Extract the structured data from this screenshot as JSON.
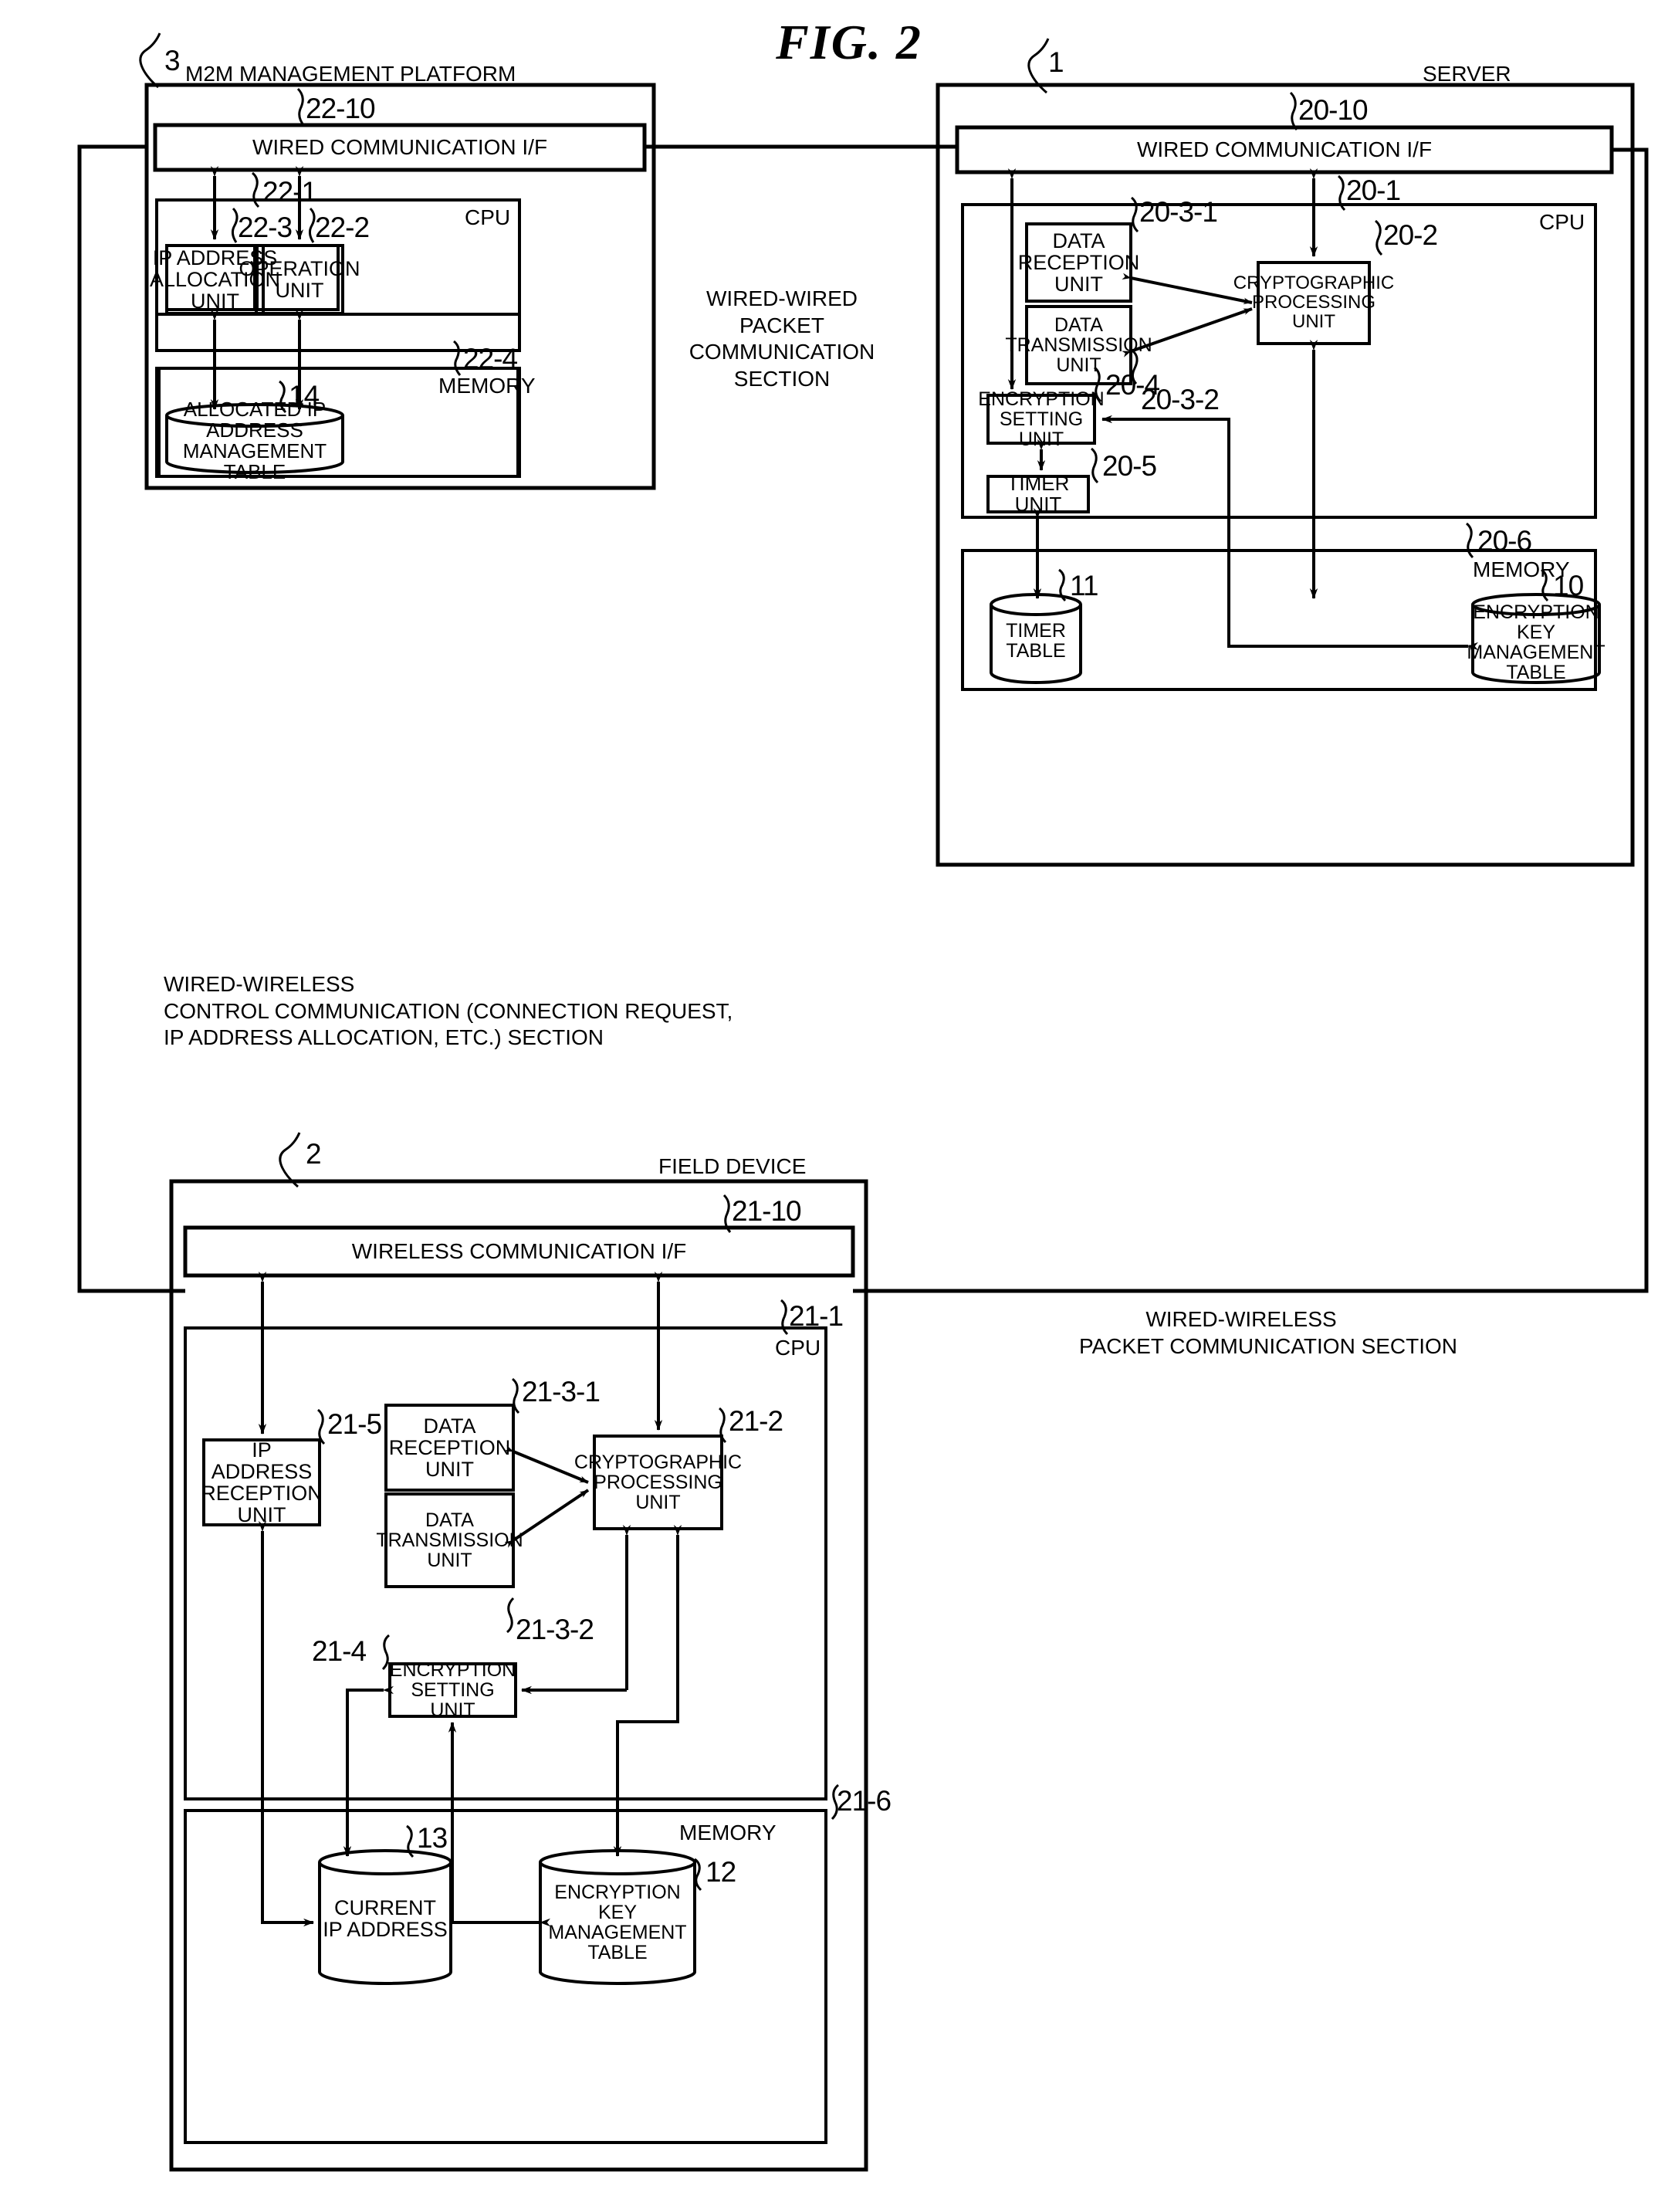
{
  "figure": {
    "title": "FIG. 2"
  },
  "blocks": {
    "m2m": {
      "name": "M2M MANAGEMENT PLATFORM",
      "ref": "3",
      "iface": {
        "label": "WIRED COMMUNICATION I/F",
        "ref": "22-10"
      },
      "cpu": {
        "tag": "CPU",
        "ref": "22-1"
      },
      "ip_alloc": {
        "label": "IP ADDRESS\nALLOCATION\nUNIT",
        "ref": "22-3"
      },
      "operation": {
        "label": "OPERATION\nUNIT",
        "ref": "22-2"
      },
      "memory": {
        "tag": "MEMORY",
        "ref": "22-4"
      },
      "alloc_table": {
        "label": "ALLOCATED IP ADDRESS\nMANAGEMENT TABLE",
        "ref": "14"
      }
    },
    "server": {
      "name": "SERVER",
      "ref": "1",
      "iface": {
        "label": "WIRED COMMUNICATION I/F",
        "ref": "20-10"
      },
      "cpu": {
        "tag": "CPU",
        "ref": "20-1"
      },
      "data_reception": {
        "label": "DATA\nRECEPTION\nUNIT",
        "ref": "20-3-1"
      },
      "data_transmission": {
        "label": "DATA\nTRANSMISSION\nUNIT",
        "ref": "20-3-2"
      },
      "crypto": {
        "label": "CRYPTOGRAPHIC\nPROCESSING\nUNIT",
        "ref": "20-2"
      },
      "enc_setting": {
        "label": "ENCRYPTION\nSETTING UNIT",
        "ref": "20-4"
      },
      "timer_unit": {
        "label": "TIMER UNIT",
        "ref": "20-5"
      },
      "memory": {
        "tag": "MEMORY",
        "ref": "20-6"
      },
      "timer_table": {
        "label": "TIMER TABLE",
        "ref": "11"
      },
      "key_table": {
        "label": "ENCRYPTION\nKEY MANAGEMENT\nTABLE",
        "ref": "10"
      }
    },
    "field": {
      "name": "FIELD DEVICE",
      "ref": "2",
      "iface": {
        "label": "WIRELESS COMMUNICATION I/F",
        "ref": "21-10"
      },
      "cpu": {
        "tag": "CPU",
        "ref": "21-1"
      },
      "ip_reception": {
        "label": "IP ADDRESS\nRECEPTION\nUNIT",
        "ref": "21-5"
      },
      "data_reception": {
        "label": "DATA\nRECEPTION\nUNIT",
        "ref": "21-3-1"
      },
      "data_transmission": {
        "label": "DATA\nTRANSMISSION\nUNIT",
        "ref": "21-3-2"
      },
      "crypto": {
        "label": "CRYPTOGRAPHIC\nPROCESSING\nUNIT",
        "ref": "21-2"
      },
      "enc_setting": {
        "label": "ENCRYPTION\nSETTING UNIT",
        "ref": "21-4"
      },
      "memory": {
        "tag": "MEMORY",
        "ref": "21-6"
      },
      "current_ip": {
        "label": "CURRENT\nIP ADDRESS",
        "ref": "13"
      },
      "key_table": {
        "label": "ENCRYPTION\nKEY MANAGEMENT\nTABLE",
        "ref": "12"
      }
    }
  },
  "annotations": {
    "wired_wired": "WIRED-WIRED\nPACKET\nCOMMUNICATION\nSECTION",
    "wired_wireless_control": "WIRED-WIRELESS\nCONTROL COMMUNICATION (CONNECTION REQUEST,\nIP ADDRESS ALLOCATION, ETC.) SECTION",
    "wired_wireless_packet": "WIRED-WIRELESS\nPACKET COMMUNICATION SECTION"
  },
  "colors": {
    "ink": "#000000",
    "paper": "#ffffff"
  }
}
